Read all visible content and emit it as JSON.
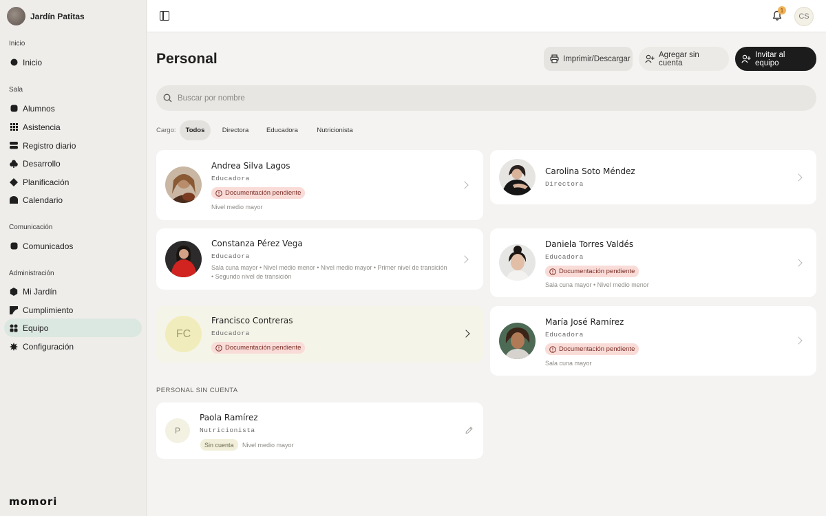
{
  "sidebar": {
    "school_name": "Jardín Patitas",
    "sections": [
      {
        "title": "Inicio",
        "items": [
          "Inicio"
        ]
      },
      {
        "title": "Sala",
        "items": [
          "Alumnos",
          "Asistencia",
          "Registro diario",
          "Desarrollo",
          "Planificación",
          "Calendario"
        ]
      },
      {
        "title": "Comunicación",
        "items": [
          "Comunicados"
        ]
      },
      {
        "title": "Administración",
        "items": [
          "Mi Jardín",
          "Cumplimiento",
          "Equipo",
          "Configuración"
        ]
      }
    ],
    "active_item": "Equipo",
    "logo": "momori"
  },
  "topbar": {
    "notification_count": "1",
    "user_initials": "CS"
  },
  "page": {
    "title": "Personal",
    "buttons": {
      "print": "Imprimir/Descargar",
      "add": "Agregar sin cuenta",
      "invite": "Invitar al equipo"
    },
    "search_placeholder": "Buscar por nombre",
    "filter": {
      "label": "Cargo:",
      "options": [
        "Todos",
        "Directora",
        "Educadora",
        "Nutricionista"
      ],
      "selected": "Todos"
    }
  },
  "staff": [
    {
      "name": "Andrea Silva Lagos",
      "role": "Educadora",
      "badge": "Documentación pendiente",
      "note": "Nivel medio mayor"
    },
    {
      "name": "Carolina Soto Méndez",
      "role": "Directora",
      "badge": "",
      "note": ""
    },
    {
      "name": "Constanza Pérez Vega",
      "role": "Educadora",
      "badge": "",
      "note": "Sala cuna mayor • Nivel medio menor • Nivel medio mayor • Primer nivel de transición",
      "note2": "• Segundo nivel de transición"
    },
    {
      "name": "Daniela Torres Valdés",
      "role": "Educadora",
      "badge": "Documentación pendiente",
      "note": "Sala cuna mayor • Nivel medio menor"
    },
    {
      "name": "Francisco Contreras",
      "role": "Educadora",
      "badge": "Documentación pendiente",
      "note": "",
      "initials": "FC"
    },
    {
      "name": "María José Ramírez",
      "role": "Educadora",
      "badge": "Documentación pendiente",
      "note": "Sala cuna mayor"
    }
  ],
  "no_account": {
    "heading": "PERSONAL SIN CUENTA",
    "person": {
      "name": "Paola Ramírez",
      "role": "Nutricionista",
      "initials": "P",
      "badge": "Sin cuenta",
      "note": "Nivel medio mayor"
    }
  },
  "colors": {
    "sidebar_bg": "#efedea",
    "active_nav": "#dbe7e1",
    "badge_bg": "#f9dcd8",
    "primary_button": "#1c1c1c",
    "highlight_card": "#f5f4e8"
  }
}
